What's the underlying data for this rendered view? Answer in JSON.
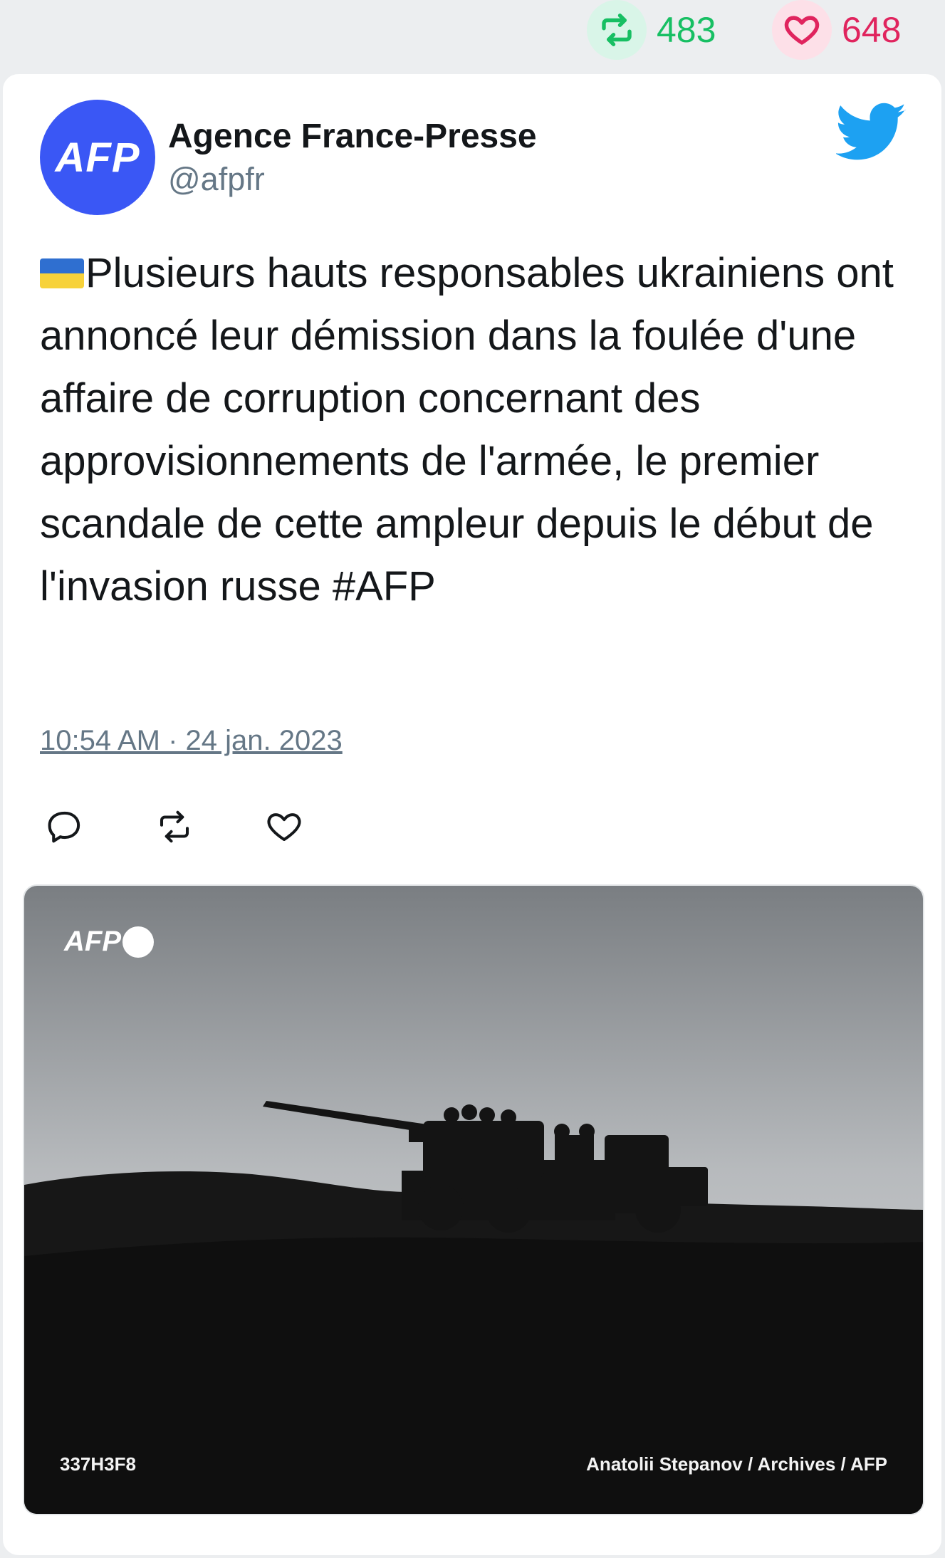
{
  "stats": {
    "retweets": "483",
    "likes": "648",
    "retweet_icon": "retweet-icon",
    "like_icon": "heart-icon",
    "retweet_color": "#17bf63",
    "like_color": "#e0245e"
  },
  "tweet": {
    "author_name": "Agence France-Presse",
    "author_handle": "@afpfr",
    "avatar_text": "AFP",
    "brand_color": "#3a57f5",
    "flag": "ukraine-flag-emoji",
    "text": "Plusieurs hauts responsables ukrainiens ont annoncé leur démission dans la foulée d'une affaire de corruption concernant des approvisionnements de l'armée, le premier scandale de cette ampleur depuis le début de l'invasion russe #AFP",
    "timestamp": "10:54 AM · 24 jan. 2023"
  },
  "actions": [
    "reply-icon",
    "retweet-icon",
    "like-icon"
  ],
  "media": {
    "watermark": "AFP",
    "photo_id": "337H3F8",
    "credit": "Anatolii Stepanov / Archives / AFP"
  }
}
